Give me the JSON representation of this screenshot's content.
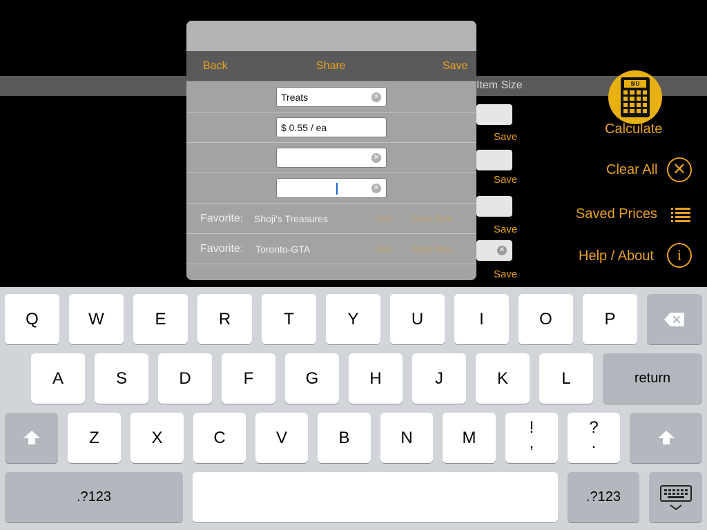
{
  "background": {
    "band_label": "Item Size",
    "save_label": "Save",
    "calc_screen": "$/U",
    "calculate_label": "Calculate",
    "clear_all_label": "Clear All",
    "saved_prices_label": "Saved Prices",
    "help_label": "Help / About",
    "accent_color": "#e8a020"
  },
  "popover": {
    "back_label": "Back",
    "share_label": "Share",
    "save_label": "Save",
    "name_value": "Treats",
    "price_value": "$ 0.55 / ea",
    "field3_value": "",
    "field4_value": "",
    "favorites": [
      {
        "label": "Favorite:",
        "value": "Shoji's Treasures",
        "use": "Use",
        "save_new": "Save New"
      },
      {
        "label": "Favorite:",
        "value": "Toronto-GTA",
        "use": "Use",
        "save_new": "Save New"
      }
    ]
  },
  "keyboard": {
    "row1": [
      "Q",
      "W",
      "E",
      "R",
      "T",
      "Y",
      "U",
      "I",
      "O",
      "P"
    ],
    "row2": [
      "A",
      "S",
      "D",
      "F",
      "G",
      "H",
      "J",
      "K",
      "L"
    ],
    "row3": [
      "Z",
      "X",
      "C",
      "V",
      "B",
      "N",
      "M"
    ],
    "return_label": "return",
    "numbers_label": ".?123",
    "punct1": [
      "!",
      ","
    ],
    "punct2": [
      "?",
      "."
    ]
  }
}
